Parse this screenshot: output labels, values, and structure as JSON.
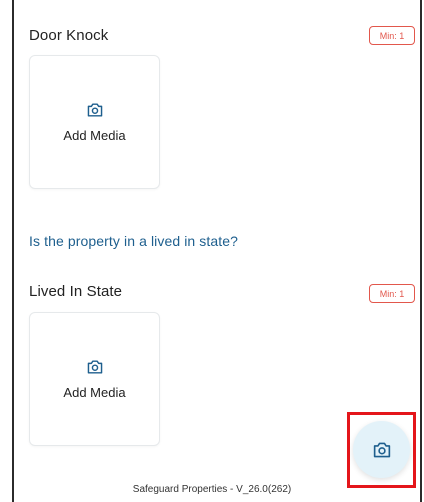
{
  "sections": [
    {
      "title": "Door Knock",
      "min_badge": "Min: 1",
      "media_card": {
        "icon": "camera-icon",
        "label": "Add Media"
      }
    },
    {
      "title": "Lived In State",
      "min_badge": "Min: 1",
      "media_card": {
        "icon": "camera-icon",
        "label": "Add Media"
      }
    }
  ],
  "question": "Is the property in a lived in state?",
  "fab": {
    "icon": "camera-icon"
  },
  "footer": "Safeguard Properties - V_26.0(262)",
  "colors": {
    "question_text": "#1e5f8e",
    "badge": "#e2574c",
    "fab_bg": "#e3f2f9",
    "highlight": "#e4161b"
  }
}
